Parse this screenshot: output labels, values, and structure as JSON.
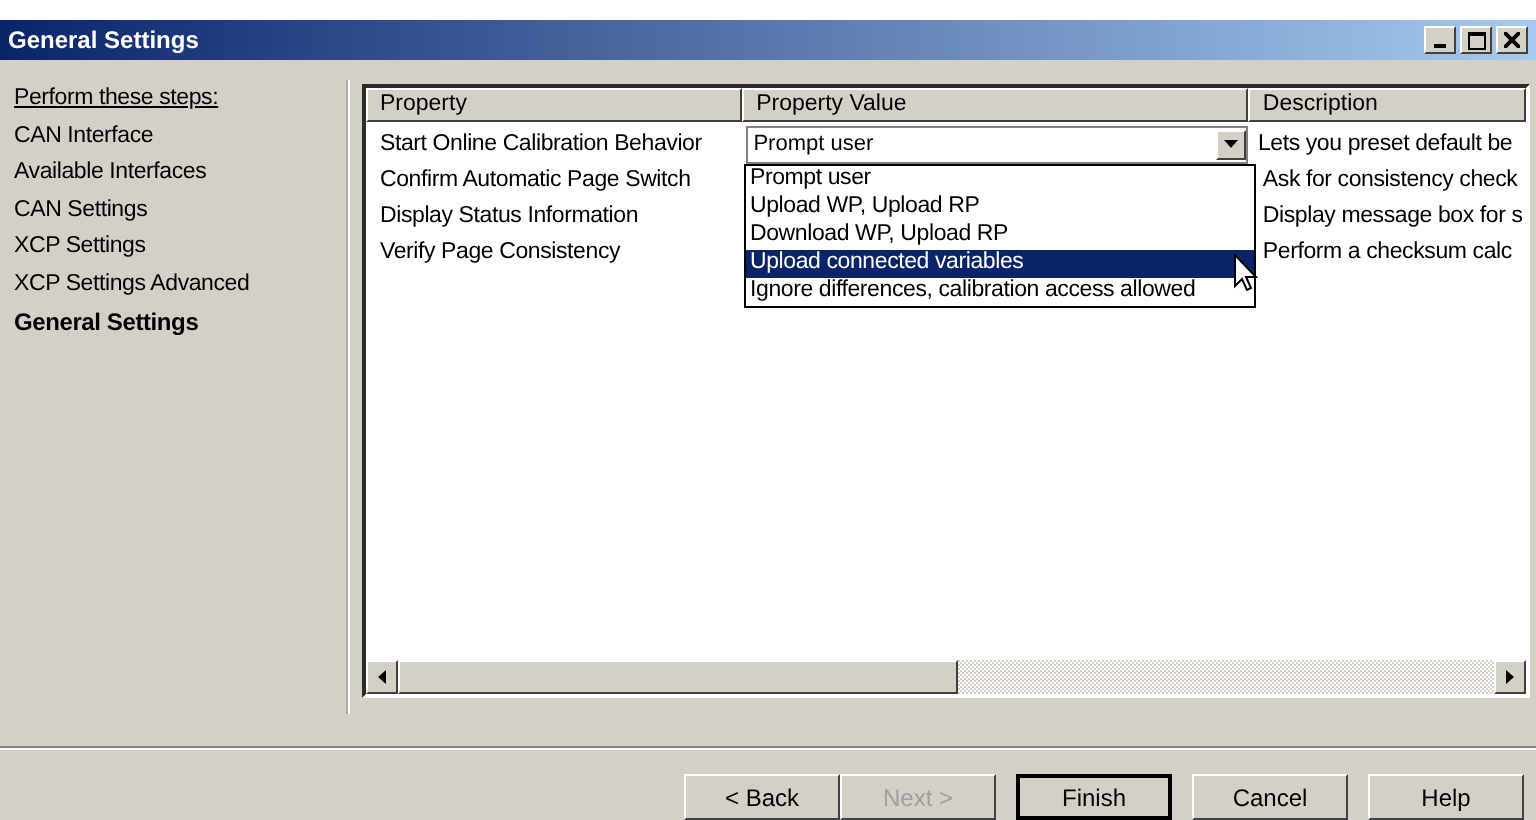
{
  "window": {
    "title": "General Settings"
  },
  "steps": {
    "heading": "Perform these steps:",
    "items": [
      {
        "label": "CAN Interface",
        "selected": false
      },
      {
        "label": "Available Interfaces",
        "selected": false
      },
      {
        "label": "CAN Settings",
        "selected": false
      },
      {
        "label": "XCP Settings",
        "selected": false
      },
      {
        "label": "XCP Settings Advanced",
        "selected": false
      },
      {
        "label": "General Settings",
        "selected": true
      }
    ]
  },
  "table": {
    "columns": [
      "Property",
      "Property Value",
      "Description"
    ],
    "rows": [
      {
        "property": "Start Online Calibration Behavior",
        "value": "Prompt user",
        "description": "Lets you preset default be",
        "editing": true
      },
      {
        "property": "Confirm Automatic Page Switch",
        "description": "Ask for consistency check",
        "editing": false
      },
      {
        "property": "Display Status Information",
        "description": "Display message box for s",
        "editing": false
      },
      {
        "property": "Verify Page Consistency",
        "description": "Perform a checksum calc",
        "editing": false
      }
    ]
  },
  "dropdown": {
    "options": [
      {
        "label": "Prompt user",
        "selected": false
      },
      {
        "label": "Upload WP, Upload RP",
        "selected": false
      },
      {
        "label": "Download WP, Upload RP",
        "selected": false
      },
      {
        "label": "Upload connected variables",
        "selected": true
      },
      {
        "label": "Ignore differences, calibration access allowed",
        "selected": false
      }
    ]
  },
  "buttons": [
    {
      "label": "< Back",
      "disabled": false,
      "default": false
    },
    {
      "label": "Next >",
      "disabled": true,
      "default": false
    },
    {
      "label": "Finish",
      "disabled": false,
      "default": true
    },
    {
      "label": "Cancel",
      "disabled": false,
      "default": false
    },
    {
      "label": "Help",
      "disabled": false,
      "default": false
    }
  ]
}
